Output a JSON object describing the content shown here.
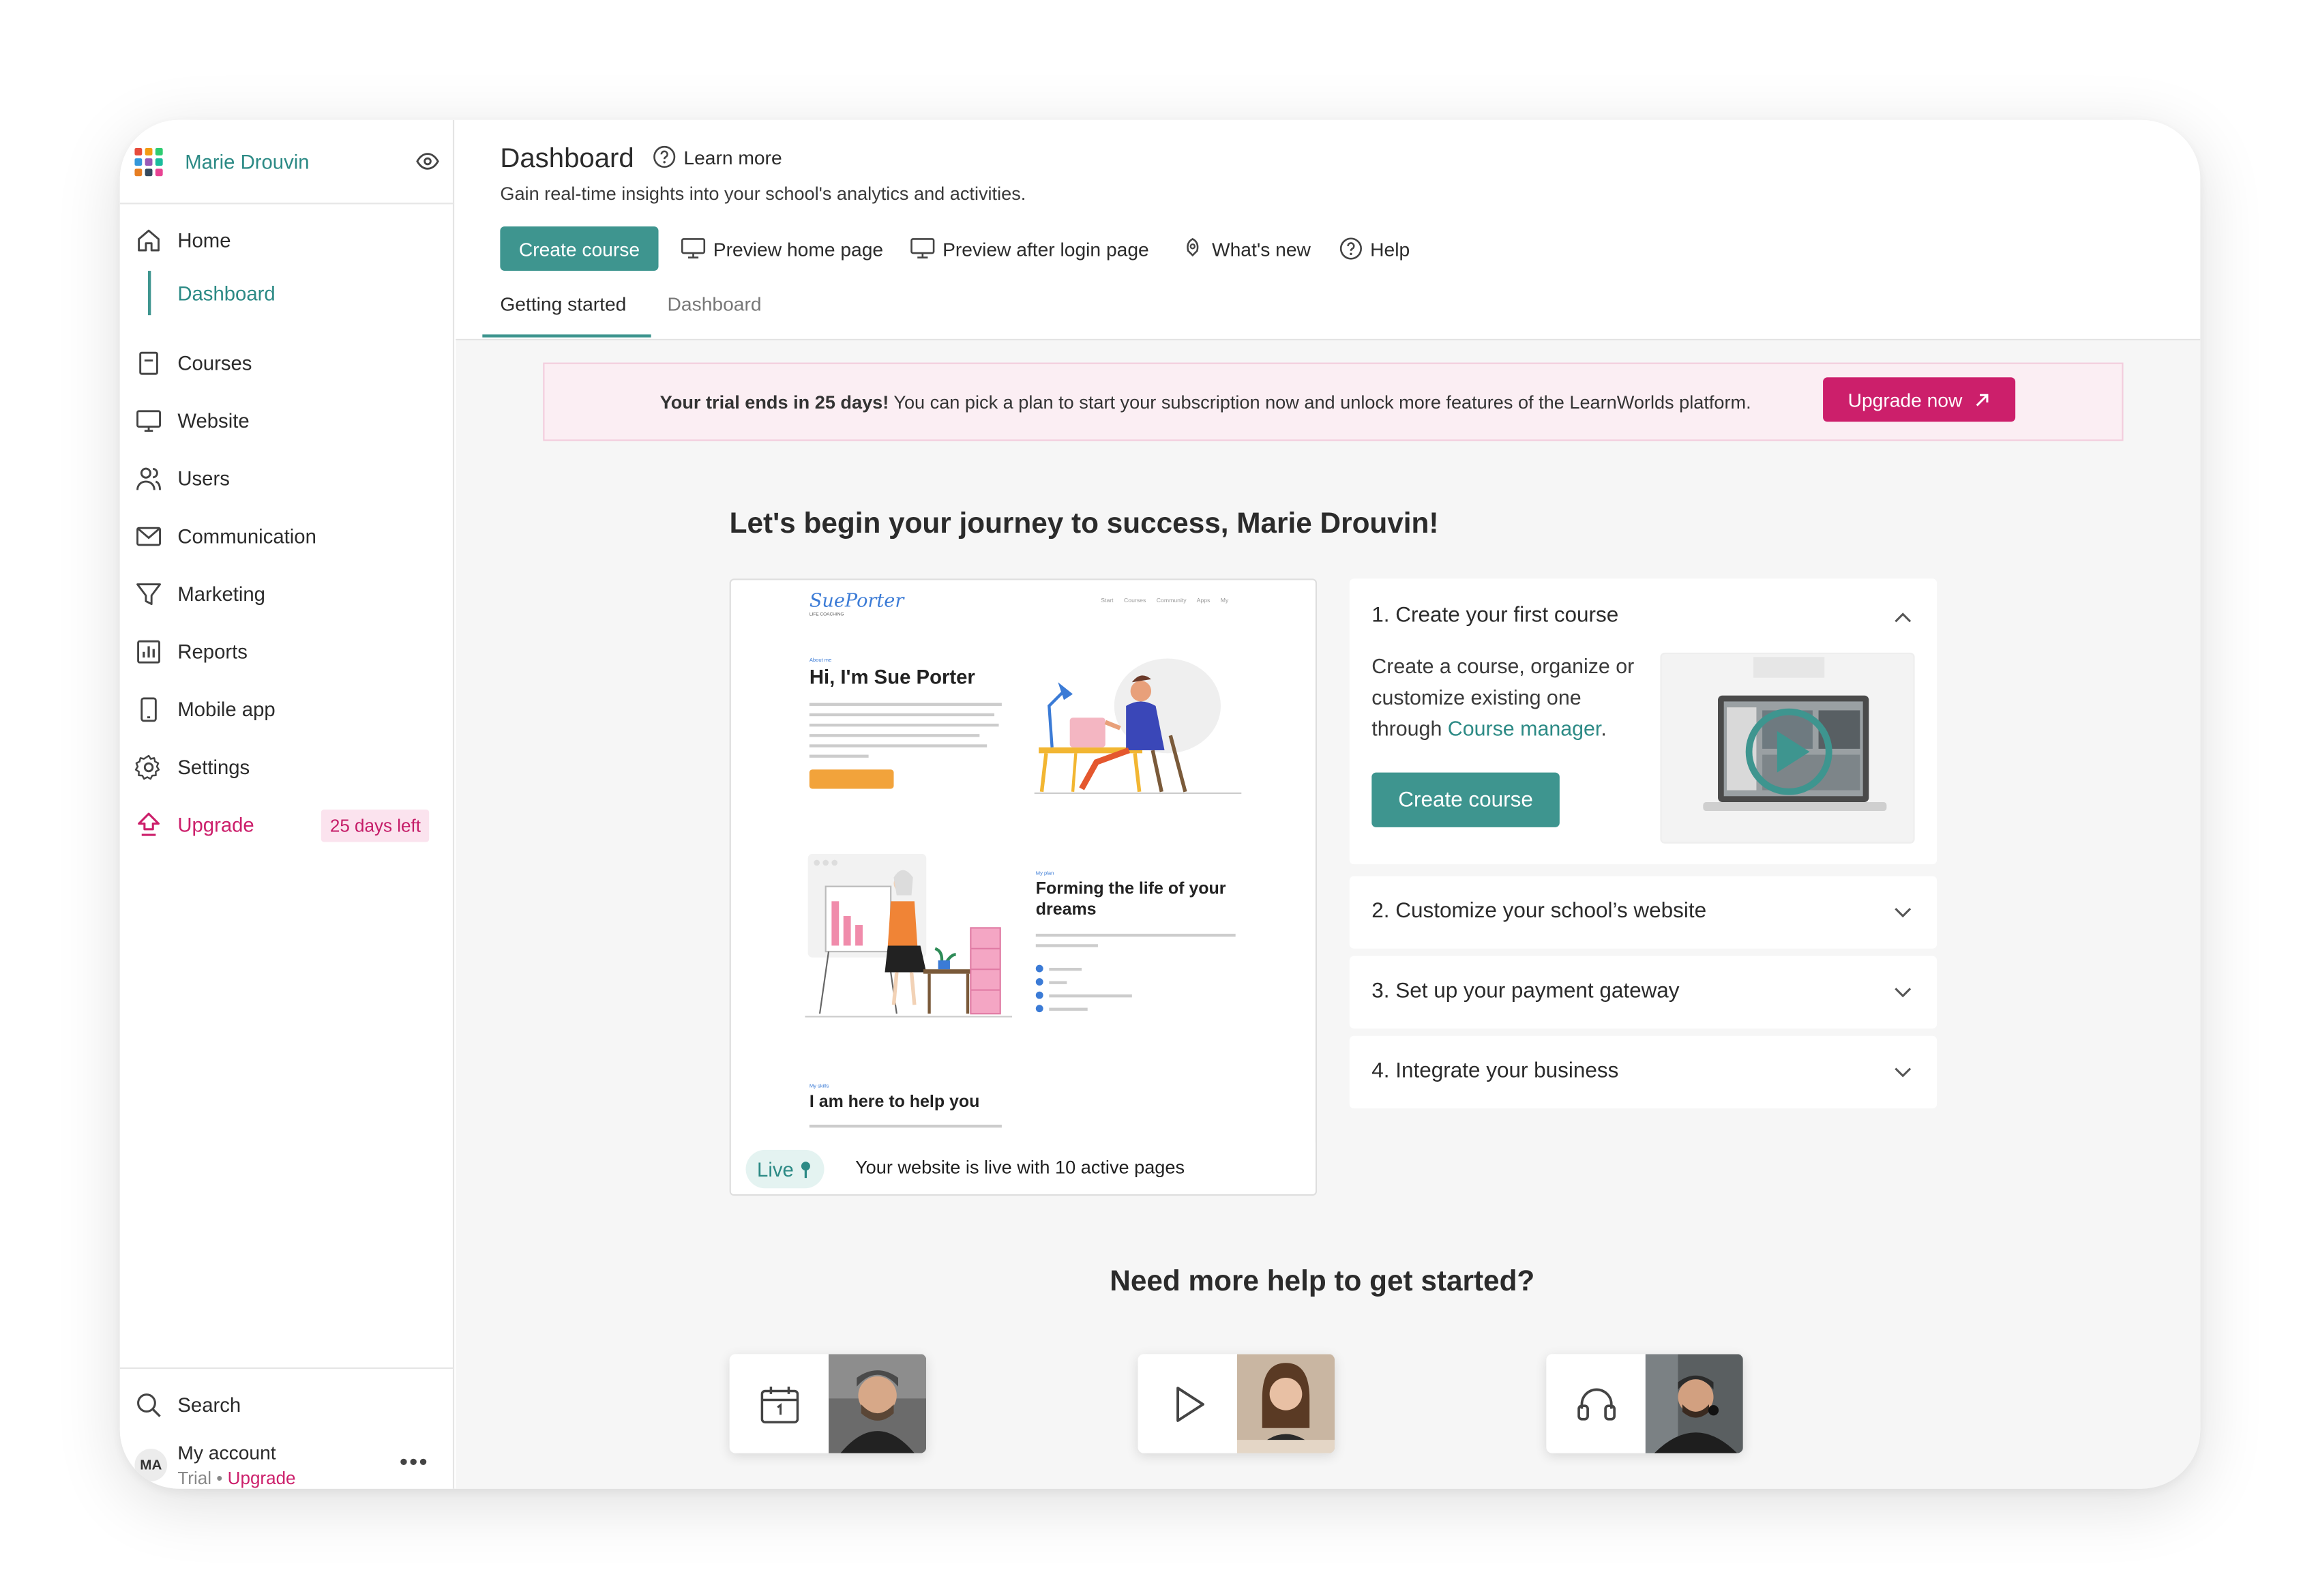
{
  "sidebar": {
    "user_name": "Marie Drouvin",
    "items": [
      {
        "label": "Home",
        "icon": "home-icon"
      },
      {
        "label": "Dashboard"
      },
      {
        "label": "Courses",
        "icon": "courses-icon"
      },
      {
        "label": "Website",
        "icon": "monitor-icon"
      },
      {
        "label": "Users",
        "icon": "users-icon"
      },
      {
        "label": "Communication",
        "icon": "mail-icon"
      },
      {
        "label": "Marketing",
        "icon": "funnel-icon"
      },
      {
        "label": "Reports",
        "icon": "bar-chart-icon"
      },
      {
        "label": "Mobile app",
        "icon": "phone-icon"
      },
      {
        "label": "Settings",
        "icon": "gear-icon"
      },
      {
        "label": "Upgrade",
        "icon": "upgrade-icon"
      }
    ],
    "days_left_badge": "25 days left",
    "search_label": "Search",
    "account": {
      "initials": "MA",
      "name": "My account",
      "plan": "Trial",
      "separator": "•",
      "upgrade": "Upgrade"
    }
  },
  "header": {
    "title": "Dashboard",
    "learn_more": "Learn more",
    "subtitle": "Gain real-time insights into your school's analytics and activities.",
    "create_course": "Create course",
    "preview_home": "Preview home page",
    "preview_after_login": "Preview after login page",
    "whats_new": "What's new",
    "help": "Help",
    "tabs": [
      {
        "label": "Getting started",
        "active": true
      },
      {
        "label": "Dashboard",
        "active": false
      }
    ]
  },
  "trial_banner": {
    "bold": "Your trial ends in 25 days!",
    "text": " You can pick a plan to start your subscription now and unlock more features of the LearnWorlds platform.",
    "button": "Upgrade now"
  },
  "journey_title": "Let's begin your journey to success, Marie Drouvin!",
  "preview_site": {
    "logo": "SuePorter",
    "logo_sub": "LIFE COACHING",
    "nav": "Start Courses Community Apps My",
    "hero_label": "About me",
    "hero_title": "Hi, I'm Sue Porter",
    "section2_label": "My plan",
    "section2_title_1": "Forming the life of your",
    "section2_title_2": "dreams",
    "section3_label": "My skills",
    "section3_title": "I am here to help you",
    "live_label": "Live",
    "live_status": "Your website is live with 10 active pages"
  },
  "steps": {
    "step1_title": "1. Create your first course",
    "step1_desc_prefix": "Create a course, organize or customize existing one through ",
    "step1_link": "Course manager",
    "step1_desc_suffix": ".",
    "step1_button": "Create course",
    "step2_title": "2. Customize your school’s website",
    "step3_title": "3. Set up your payment gateway",
    "step4_title": "4. Integrate your business"
  },
  "need_help_title": "Need more help to get started?",
  "help_cards": [
    {
      "icon": "calendar-icon"
    },
    {
      "icon": "play-icon"
    },
    {
      "icon": "headset-icon"
    }
  ],
  "colors": {
    "teal": "#3e958f",
    "pink": "#cc1f6b",
    "banner_bg": "#fbeef3",
    "content_bg": "#f6f6f6"
  }
}
